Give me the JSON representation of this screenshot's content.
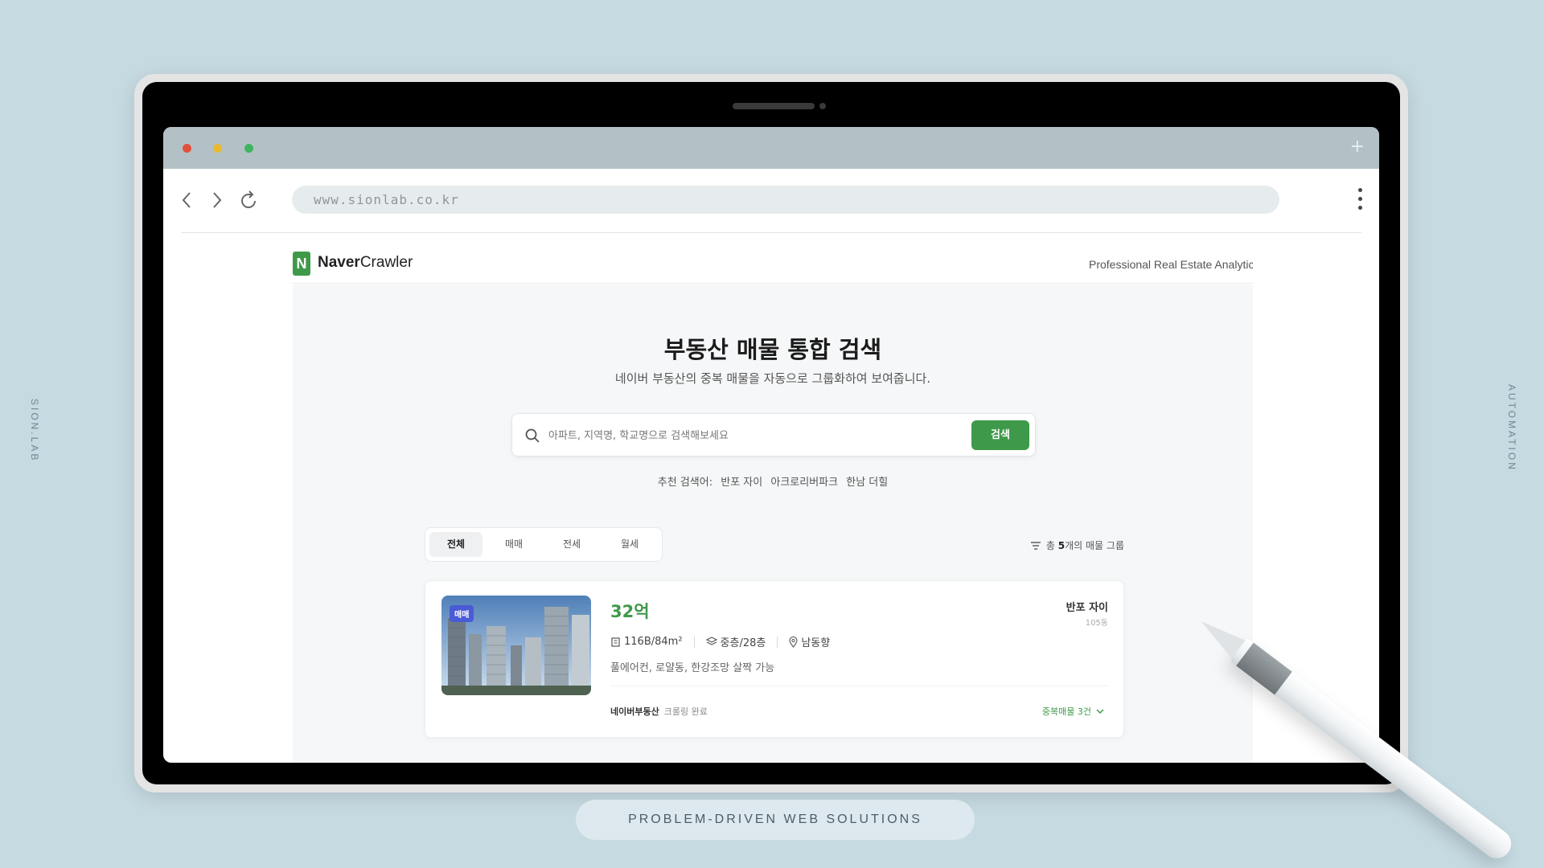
{
  "side_left": "SION.LAB",
  "side_right": "AUTOMATION",
  "bottom_tagline": "PROBLEM-DRIVEN WEB SOLUTIONS",
  "browser": {
    "url": "www.sionlab.co.kr",
    "new_tab": "+"
  },
  "app": {
    "logo_letter": "N",
    "logo_bold": "Naver",
    "logo_light": "Crawler",
    "tagline": "Professional Real Estate Analytic",
    "hero_title": "부동산 매물 통합 검색",
    "hero_sub": "네이버 부동산의 중복 매물을 자동으로 그룹화하여 보여줍니다.",
    "search": {
      "placeholder": "아파트, 지역명, 학교명으로 검색해보세요",
      "button": "검색"
    },
    "recommend": {
      "label": "추천 검색어:",
      "items": [
        "반포 자이",
        "아크로리버파크",
        "한남 더힐"
      ]
    },
    "tabs": [
      "전체",
      "매매",
      "전세",
      "월세"
    ],
    "active_tab": 0,
    "summary": {
      "prefix": "총",
      "count": "5",
      "suffix": "개의 매물 그룹"
    },
    "listing": {
      "badge": "매매",
      "price": "32억",
      "complex": "반포 자이",
      "dong": "105동",
      "area": "116B/84m²",
      "floor": "중층/28층",
      "direction": "남동향",
      "description": "풀에어컨, 로얄동, 한강조망 살짝 가능",
      "source": "네이버부동산",
      "status": "크롤링 완료",
      "duplicates": "중복매물 3건"
    }
  },
  "colors": {
    "background": "#c6dae2",
    "brand_green": "#3e9a4a",
    "badge_blue": "#4a5bd6"
  }
}
